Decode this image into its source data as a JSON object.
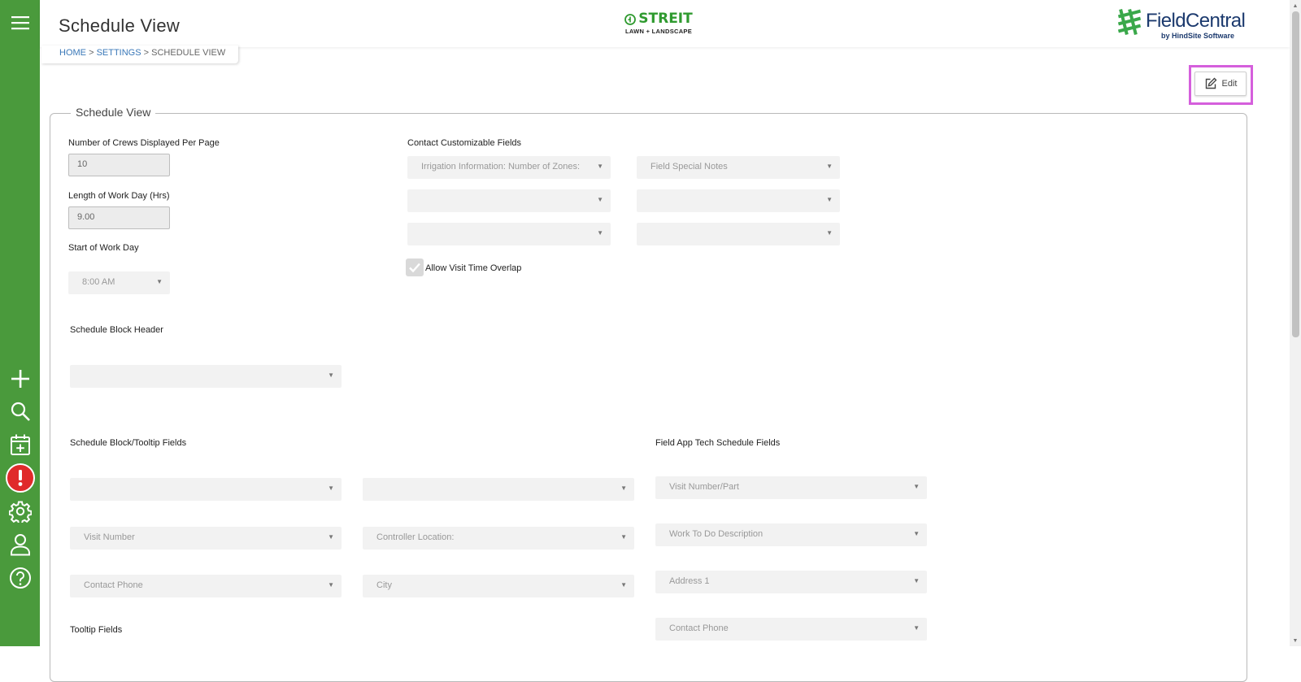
{
  "sidebar": {
    "icons": [
      "menu-icon",
      "plus-icon",
      "search-icon",
      "calendar-add-icon",
      "alert-icon",
      "gear-icon",
      "user-icon",
      "help-icon"
    ],
    "accent": "#4a9a3c",
    "alert_color": "#e02a2a"
  },
  "header": {
    "title": "Schedule View",
    "company_logo": {
      "name": "STREIT",
      "tagline": "LAWN + LANDSCAPE"
    },
    "product_logo": {
      "name": "FieldCentral",
      "tagline": "by HindSite Software"
    }
  },
  "breadcrumb": {
    "home": "HOME",
    "sep": ">",
    "settings": "SETTINGS",
    "current": "SCHEDULE VIEW"
  },
  "toolbar": {
    "edit_label": "Edit",
    "highlight_color": "#d55fdc"
  },
  "form": {
    "legend": "Schedule View",
    "crews_label": "Number of Crews Displayed Per Page",
    "crews_value": "10",
    "workday_length_label": "Length of Work Day (Hrs)",
    "workday_length_value": "9.00",
    "start_label": "Start of Work Day",
    "start_value": "8:00 AM",
    "contact_fields_label": "Contact Customizable Fields",
    "contact_fields": [
      "Irrigation Information: Number of Zones:",
      "Field Special Notes",
      "",
      "",
      "",
      ""
    ],
    "allow_overlap_label": "Allow Visit Time Overlap",
    "allow_overlap_checked": true,
    "block_header_label": "Schedule Block Header",
    "block_header_value": "",
    "block_tooltip_label": "Schedule Block/Tooltip Fields",
    "block_tooltip_col1": [
      "",
      "Visit Number",
      "Contact Phone"
    ],
    "block_tooltip_col2": [
      "",
      "Controller Location:",
      "City"
    ],
    "field_app_label": "Field App Tech Schedule Fields",
    "field_app_fields": [
      "Visit Number/Part",
      "Work To Do Description",
      "Address 1",
      "Contact Phone"
    ],
    "tooltip_label": "Tooltip Fields"
  }
}
